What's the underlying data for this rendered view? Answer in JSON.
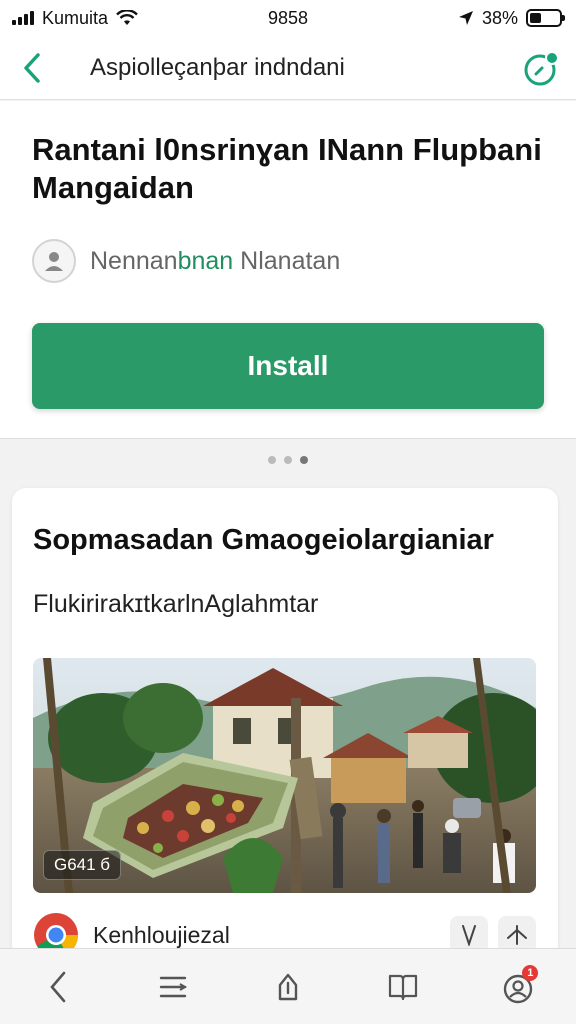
{
  "status_bar": {
    "carrier": "Kumuita",
    "time": "9858",
    "battery_percent": "38%",
    "battery_level": 0.38
  },
  "header": {
    "title": "Aspiolleçanþar indndani",
    "back_icon": "chevron-left-icon",
    "action_icon": "compass-icon",
    "accent_color": "#1aa37a"
  },
  "app": {
    "title": "Rantani l0nsrinɣan INann Flupbani Mangaidan",
    "developer_prefix": "Nennanbnan",
    "developer_highlight": "bnan",
    "developer_suffix": "Nlanatan",
    "install_label": "Install",
    "install_color": "#2a9a68"
  },
  "carousel": {
    "page_count": 3,
    "active_index": 2
  },
  "card": {
    "title": "Sopmasadan Gmaogeiolargianiar",
    "subtitle": "FlukirirakɪtkarlnAglahmtar",
    "image_badge": "G641 б",
    "source_name": "Kenhloujiezal",
    "source_icon": "chrome-icon",
    "actions": [
      "thumbs-down-icon",
      "thumbs-up-icon"
    ]
  },
  "bottom_nav": {
    "items": [
      "back-icon",
      "menu-icon",
      "share-icon",
      "bookmarks-icon",
      "profile-icon"
    ],
    "notification_count": "1"
  }
}
